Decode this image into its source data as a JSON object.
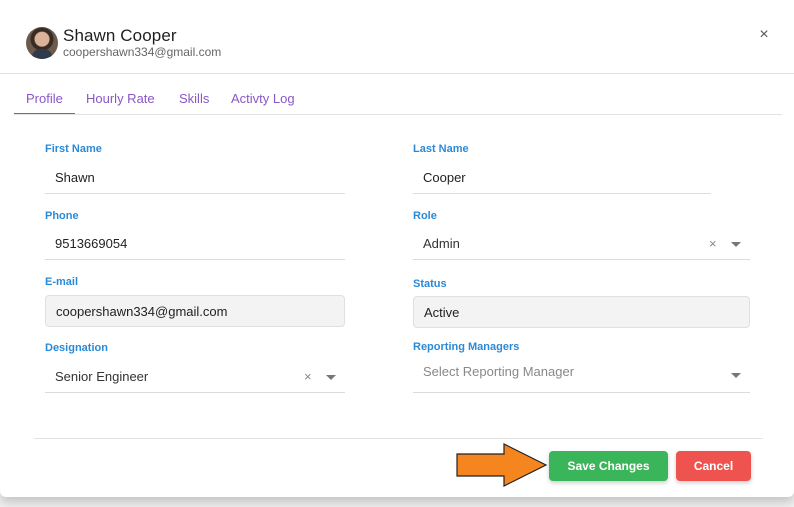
{
  "user": {
    "name": "Shawn Cooper",
    "email": "coopershawn334@gmail.com"
  },
  "close_glyph": "×",
  "tabs": [
    {
      "label": "Profile",
      "active": true
    },
    {
      "label": "Hourly Rate",
      "active": false
    },
    {
      "label": "Skills",
      "active": false
    },
    {
      "label": "Activty Log",
      "active": false
    }
  ],
  "form": {
    "first_name": {
      "label": "First Name",
      "value": "Shawn"
    },
    "last_name": {
      "label": "Last Name",
      "value": "Cooper"
    },
    "phone": {
      "label": "Phone",
      "value": "9513669054"
    },
    "role": {
      "label": "Role",
      "value": "Admin"
    },
    "email": {
      "label": "E-mail",
      "value": "coopershawn334@gmail.com"
    },
    "status": {
      "label": "Status",
      "value": "Active"
    },
    "designation": {
      "label": "Designation",
      "value": "Senior Engineer"
    },
    "reporting_managers": {
      "label": "Reporting Managers",
      "placeholder": "Select Reporting Manager"
    }
  },
  "clear_glyph": "×",
  "actions": {
    "save_label": "Save Changes",
    "cancel_label": "Cancel"
  },
  "colors": {
    "accent": "#8a57c7",
    "label": "#2b8ad6",
    "save": "#3bb55a",
    "cancel": "#ef5350",
    "arrow": "#f5861f"
  },
  "icons": {
    "close": "close-icon",
    "clear": "clear-icon",
    "dropdown": "chevron-down-icon",
    "pointer": "arrow-right-icon"
  }
}
